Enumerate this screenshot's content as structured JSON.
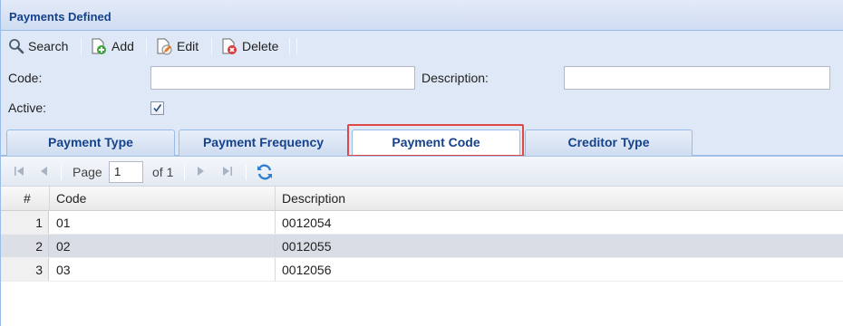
{
  "panel": {
    "title": "Payments Defined"
  },
  "toolbar": {
    "search_label": "Search",
    "add_label": "Add",
    "edit_label": "Edit",
    "delete_label": "Delete"
  },
  "form": {
    "code_label": "Code:",
    "code_value": "",
    "description_label": "Description:",
    "description_value": "",
    "active_label": "Active:",
    "active_checked": true
  },
  "tabs": [
    {
      "label": "Payment Type"
    },
    {
      "label": "Payment Frequency"
    },
    {
      "label": "Payment Code",
      "active": true
    },
    {
      "label": "Creditor Type"
    }
  ],
  "pager": {
    "page_label": "Page",
    "page_value": "1",
    "of_label": "of 1"
  },
  "grid": {
    "columns": [
      "#",
      "Code",
      "Description"
    ],
    "rows": [
      {
        "num": "1",
        "code": "01",
        "description": "0012054"
      },
      {
        "num": "2",
        "code": "02",
        "description": "0012055"
      },
      {
        "num": "3",
        "code": "03",
        "description": "0012056"
      }
    ]
  },
  "colors": {
    "highlight": "#e04848",
    "tab_text": "#15428b",
    "selected_row": "#d8dde6"
  }
}
